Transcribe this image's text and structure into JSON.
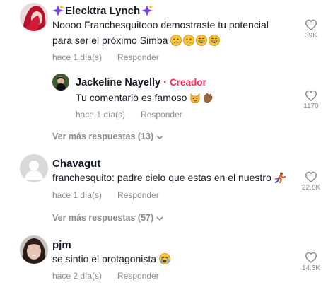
{
  "comments": [
    {
      "author": "Elecktra Lynch",
      "text": "Noooo Franchesquitooo demostraste tu potencial para ser el próximo Simba",
      "time": "hace 1 día(s)",
      "reply": "Responder",
      "likes": "39K",
      "emoji_icons": [
        "sad-face-icon",
        "sad-face-icon",
        "grin-face-icon",
        "grin-face-icon"
      ],
      "reply_thread": {
        "author": "Jackeline Nayelly",
        "badge_sep": "·",
        "badge": "Creador",
        "text": "Tu comentario es famoso",
        "time": "hace 1 día(s)",
        "reply": "Responder",
        "likes": "1170",
        "emoji_icons": [
          "cat-face-icon",
          "clap-hands-icon"
        ]
      },
      "more_replies": "Ver más respuestas (13)"
    },
    {
      "author": "Chavagut",
      "text": "franchesquito: padre cielo que estas en el nuestro",
      "time": "hace 1 día(s)",
      "reply": "Responder",
      "likes": "22.8K",
      "emoji_icons": [
        "running-person-icon"
      ],
      "more_replies": "Ver más respuestas (57)"
    },
    {
      "author": "pjm",
      "text": "se sintio el protagonista",
      "time": "hace 2 día(s)",
      "reply": "Responder",
      "likes": "14.3K",
      "emoji_icons": [
        "crying-face-icon"
      ]
    }
  ],
  "colors": {
    "accent": "#fe2c55",
    "muted": "#8a8b91",
    "text": "#161823"
  }
}
